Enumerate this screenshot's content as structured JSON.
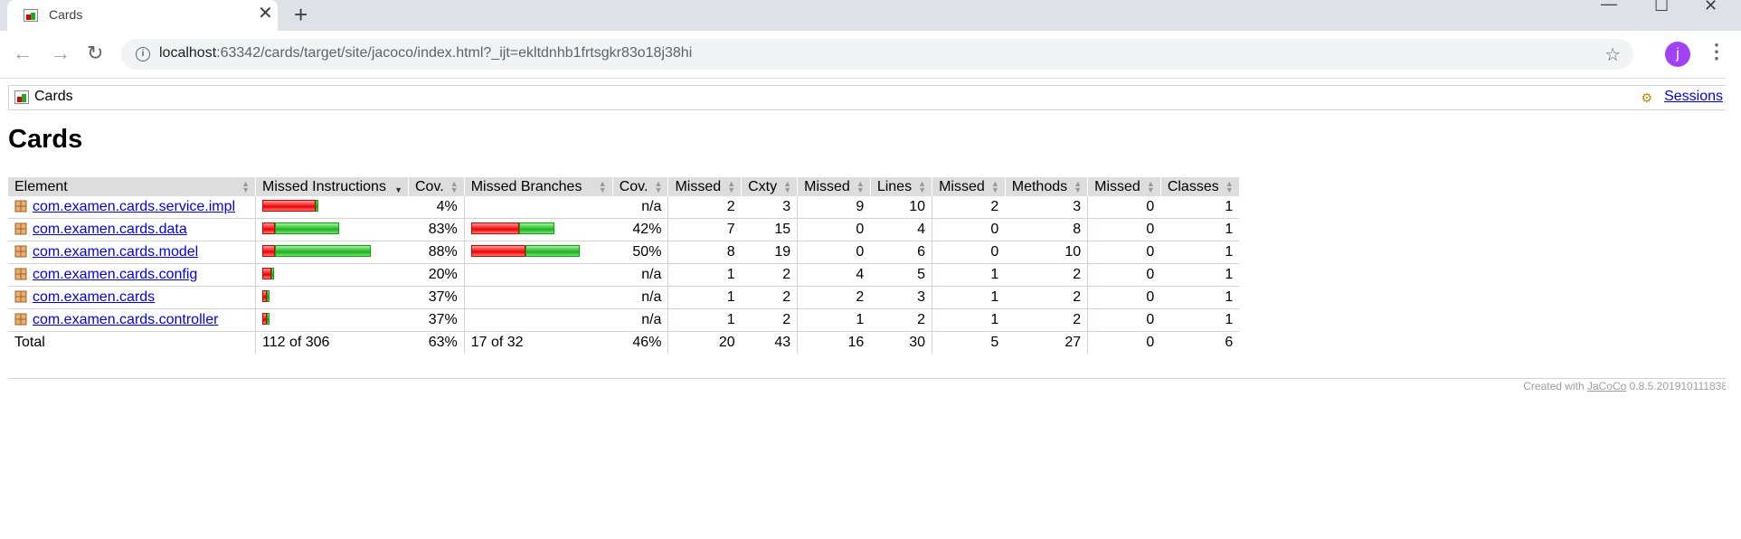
{
  "browser": {
    "tab_title": "Cards",
    "new_tab": "+",
    "url_host": "localhost",
    "url_rest": ":63342/cards/target/site/jacoco/index.html?_ijt=ekltdnhb1frtsgkr83o18j38hi",
    "profile_initial": "j"
  },
  "breadcrumb": {
    "label": "Cards",
    "sessions_link": "Sessions"
  },
  "page_title": "Cards",
  "table": {
    "headers": [
      "Element",
      "Missed Instructions",
      "Cov.",
      "Missed Branches",
      "Cov.",
      "Missed",
      "Cxty",
      "Missed",
      "Lines",
      "Missed",
      "Methods",
      "Missed",
      "Classes"
    ],
    "rows": [
      {
        "name": "com.examen.cards.service.impl",
        "instr_missed_frac": 0.96,
        "instr_total_rel": 0.51,
        "instr_cov": "4%",
        "branch_missed_frac": null,
        "branch_total_rel": 0,
        "branch_cov": "n/a",
        "cxty_missed": "2",
        "cxty": "3",
        "lines_missed": "9",
        "lines": "10",
        "methods_missed": "2",
        "methods": "3",
        "classes_missed": "0",
        "classes": "1"
      },
      {
        "name": "com.examen.cards.data",
        "instr_missed_frac": 0.17,
        "instr_total_rel": 0.71,
        "instr_cov": "83%",
        "branch_missed_frac": 0.58,
        "branch_total_rel": 0.77,
        "branch_cov": "42%",
        "cxty_missed": "7",
        "cxty": "15",
        "lines_missed": "0",
        "lines": "4",
        "methods_missed": "0",
        "methods": "8",
        "classes_missed": "0",
        "classes": "1"
      },
      {
        "name": "com.examen.cards.model",
        "instr_missed_frac": 0.12,
        "instr_total_rel": 1.0,
        "instr_cov": "88%",
        "branch_missed_frac": 0.5,
        "branch_total_rel": 1.0,
        "branch_cov": "50%",
        "cxty_missed": "8",
        "cxty": "19",
        "lines_missed": "0",
        "lines": "6",
        "methods_missed": "0",
        "methods": "10",
        "classes_missed": "0",
        "classes": "1"
      },
      {
        "name": "com.examen.cards.config",
        "instr_missed_frac": 0.8,
        "instr_total_rel": 0.1,
        "instr_cov": "20%",
        "branch_missed_frac": null,
        "branch_total_rel": 0,
        "branch_cov": "n/a",
        "cxty_missed": "1",
        "cxty": "2",
        "lines_missed": "4",
        "lines": "5",
        "methods_missed": "1",
        "methods": "2",
        "classes_missed": "0",
        "classes": "1"
      },
      {
        "name": "com.examen.cards",
        "instr_missed_frac": 0.63,
        "instr_total_rel": 0.05,
        "instr_cov": "37%",
        "branch_missed_frac": null,
        "branch_total_rel": 0,
        "branch_cov": "n/a",
        "cxty_missed": "1",
        "cxty": "2",
        "lines_missed": "2",
        "lines": "3",
        "methods_missed": "1",
        "methods": "2",
        "classes_missed": "0",
        "classes": "1"
      },
      {
        "name": "com.examen.cards.controller",
        "instr_missed_frac": 0.63,
        "instr_total_rel": 0.05,
        "instr_cov": "37%",
        "branch_missed_frac": null,
        "branch_total_rel": 0,
        "branch_cov": "n/a",
        "cxty_missed": "1",
        "cxty": "2",
        "lines_missed": "1",
        "lines": "2",
        "methods_missed": "1",
        "methods": "2",
        "classes_missed": "0",
        "classes": "1"
      }
    ],
    "total": {
      "label": "Total",
      "instr": "112 of 306",
      "instr_cov": "63%",
      "branch": "17 of 32",
      "branch_cov": "46%",
      "cxty_missed": "20",
      "cxty": "43",
      "lines_missed": "16",
      "lines": "30",
      "methods_missed": "5",
      "methods": "27",
      "classes_missed": "0",
      "classes": "6"
    }
  },
  "footer": {
    "prefix": "Created with ",
    "link": "JaCoCo",
    "suffix": " 0.8.5.201910111838"
  },
  "colors": {
    "red": "#ee0000",
    "green": "#1bb31b",
    "link": "#0000ee",
    "header_bg": "#dddddd"
  }
}
